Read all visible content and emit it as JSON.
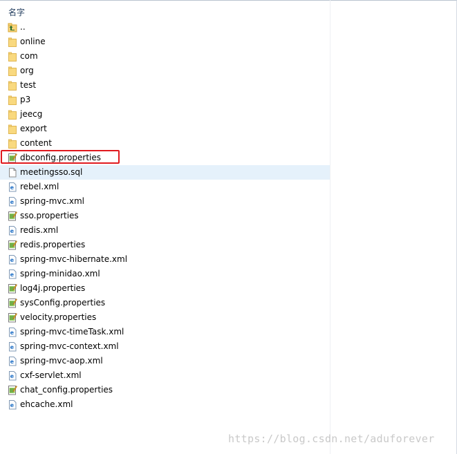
{
  "header": {
    "name_column": "名字"
  },
  "files": [
    {
      "name": "..",
      "kind": "up",
      "icon": "up-folder-icon"
    },
    {
      "name": "online",
      "kind": "folder",
      "icon": "folder-icon"
    },
    {
      "name": "com",
      "kind": "folder",
      "icon": "folder-icon"
    },
    {
      "name": "org",
      "kind": "folder",
      "icon": "folder-icon"
    },
    {
      "name": "test",
      "kind": "folder",
      "icon": "folder-icon"
    },
    {
      "name": "p3",
      "kind": "folder",
      "icon": "folder-icon"
    },
    {
      "name": "jeecg",
      "kind": "folder",
      "icon": "folder-icon"
    },
    {
      "name": "export",
      "kind": "folder",
      "icon": "folder-icon"
    },
    {
      "name": "content",
      "kind": "folder",
      "icon": "folder-icon"
    },
    {
      "name": "dbconfig.properties",
      "kind": "properties",
      "icon": "properties-file-icon"
    },
    {
      "name": "meetingsso.sql",
      "kind": "sql",
      "icon": "text-file-icon",
      "selected": true
    },
    {
      "name": "rebel.xml",
      "kind": "xml",
      "icon": "xml-file-icon"
    },
    {
      "name": "spring-mvc.xml",
      "kind": "xml",
      "icon": "xml-file-icon"
    },
    {
      "name": "sso.properties",
      "kind": "properties",
      "icon": "properties-file-icon"
    },
    {
      "name": "redis.xml",
      "kind": "xml",
      "icon": "xml-file-icon"
    },
    {
      "name": "redis.properties",
      "kind": "properties",
      "icon": "properties-file-icon"
    },
    {
      "name": "spring-mvc-hibernate.xml",
      "kind": "xml",
      "icon": "xml-file-icon"
    },
    {
      "name": "spring-minidao.xml",
      "kind": "xml",
      "icon": "xml-file-icon"
    },
    {
      "name": "log4j.properties",
      "kind": "properties",
      "icon": "properties-file-icon"
    },
    {
      "name": "sysConfig.properties",
      "kind": "properties",
      "icon": "properties-file-icon"
    },
    {
      "name": "velocity.properties",
      "kind": "properties",
      "icon": "properties-file-icon"
    },
    {
      "name": "spring-mvc-timeTask.xml",
      "kind": "xml",
      "icon": "xml-file-icon"
    },
    {
      "name": "spring-mvc-context.xml",
      "kind": "xml",
      "icon": "xml-file-icon"
    },
    {
      "name": "spring-mvc-aop.xml",
      "kind": "xml",
      "icon": "xml-file-icon"
    },
    {
      "name": "cxf-servlet.xml",
      "kind": "xml",
      "icon": "xml-file-icon"
    },
    {
      "name": "chat_config.properties",
      "kind": "properties",
      "icon": "properties-file-icon"
    },
    {
      "name": "ehcache.xml",
      "kind": "xml",
      "icon": "xml-file-icon"
    }
  ],
  "highlighted_file": "dbconfig.properties",
  "watermark": "https://blog.csdn.net/aduforever",
  "colors": {
    "highlight_border": "#e0191e",
    "selection": "#e5f1fb",
    "folder": "#f6d47a",
    "xml_icon": "#1f6fc5"
  }
}
